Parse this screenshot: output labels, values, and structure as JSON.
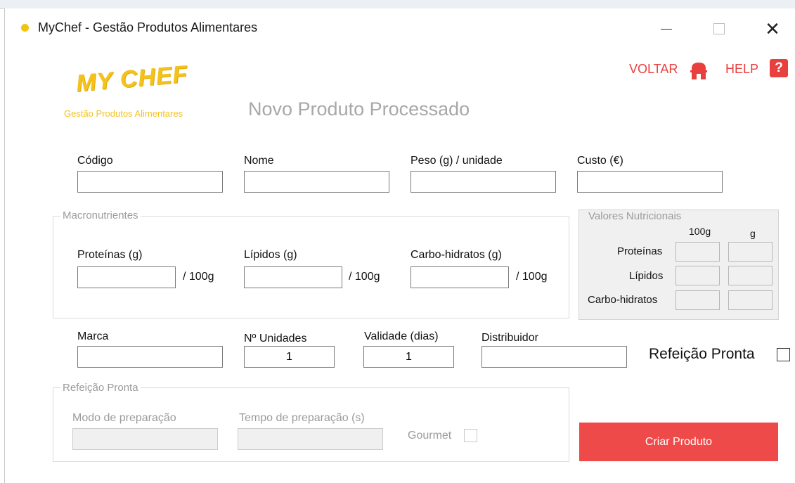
{
  "window": {
    "title": "MyChef - Gestão Produtos Alimentares"
  },
  "nav": {
    "voltar": "VOLTAR",
    "help": "HELP",
    "help_glyph": "?"
  },
  "logo": {
    "main": "MY CHEF",
    "subtitle": "Gestão Produtos Alimentares"
  },
  "page_title": "Novo Produto Processado",
  "fields": {
    "codigo": {
      "label": "Código",
      "value": ""
    },
    "nome": {
      "label": "Nome",
      "value": ""
    },
    "peso": {
      "label": "Peso (g) / unidade",
      "value": ""
    },
    "custo": {
      "label": "Custo (€)",
      "value": ""
    }
  },
  "macronutrientes": {
    "legend": "Macronutrientes",
    "proteinas": {
      "label": "Proteínas (g)",
      "value": "",
      "suffix": "/ 100g"
    },
    "lipidos": {
      "label": "Lípidos (g)",
      "value": "",
      "suffix": "/ 100g"
    },
    "carbo": {
      "label": "Carbo-hidratos (g)",
      "value": "",
      "suffix": "/ 100g"
    }
  },
  "valores_nutricionais": {
    "legend": "Valores Nutricionais",
    "col_100g": "100g",
    "col_g": "g",
    "rows": [
      "Proteínas",
      "Lípidos",
      "Carbo-hidratos"
    ]
  },
  "extra": {
    "marca": {
      "label": "Marca",
      "value": ""
    },
    "unidades": {
      "label": "Nº Unidades",
      "value": "1"
    },
    "validade": {
      "label": "Validade (dias)",
      "value": "1"
    },
    "distribuidor": {
      "label": "Distribuidor",
      "value": ""
    }
  },
  "refeicao_checkbox": {
    "label": "Refeição Pronta",
    "checked": false
  },
  "refeicao_group": {
    "legend": "Refeição Pronta",
    "modo": {
      "label": "Modo de preparação",
      "value": ""
    },
    "tempo": {
      "label": "Tempo de preparação (s)",
      "value": ""
    },
    "gourmet": {
      "label": "Gourmet",
      "checked": false
    }
  },
  "actions": {
    "criar": "Criar Produto"
  },
  "colors": {
    "accent": "#ef4a4a",
    "brand": "#f4c21f",
    "disabled_text": "#9b9b9b"
  }
}
